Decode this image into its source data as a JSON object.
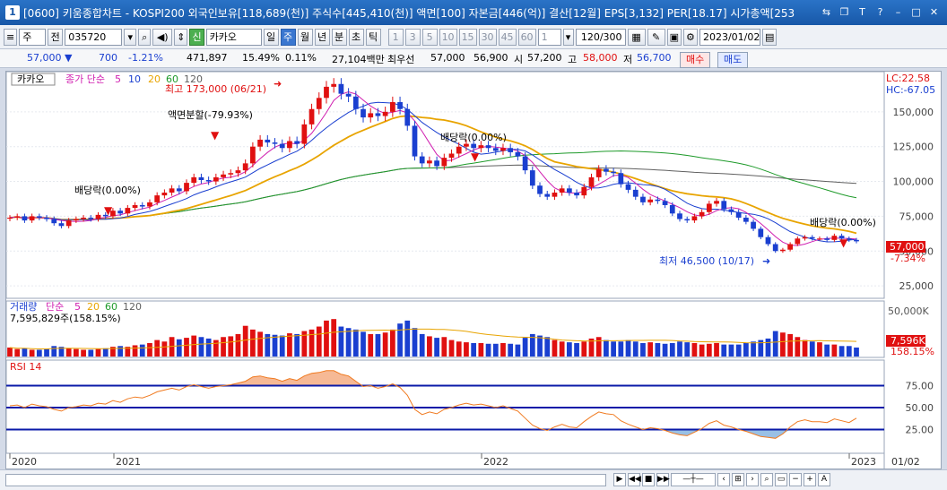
{
  "window": {
    "title": "[0600] 키움종합차트 - KOSPI200 외국인보유[118,689(천)] 주식수[445,410(천)] 액면[100] 자본금[446(억)] 결산[12월] EPS[3,132] PER[18.17] 시가총액[253",
    "app_number": "1"
  },
  "toolbar": {
    "period_select": "주",
    "all_label": "전",
    "code": "035720",
    "stock_name": "카카오",
    "periods": [
      "일",
      "주",
      "월",
      "년",
      "분",
      "초",
      "틱"
    ],
    "active_period": "주",
    "numbers": [
      "1",
      "3",
      "5",
      "10",
      "15",
      "30",
      "45",
      "60"
    ],
    "count_value": "1",
    "range": "120/300",
    "date": "2023/01/02"
  },
  "quote": {
    "price": "57,000",
    "change": "700",
    "change_pct": "-1.21%",
    "volume": "471,897",
    "vol_ratio": "15.49%",
    "turnover": "0.11%",
    "amount": "27,104백만",
    "best_label": "최우선",
    "ask": "57,000",
    "bid": "56,900",
    "open_label": "시",
    "open": "57,200",
    "high_label": "고",
    "high": "58,000",
    "low_label": "저",
    "low": "56,700",
    "buy_label": "매수",
    "sell_label": "매도"
  },
  "price_panel": {
    "stock_tag": "카카오",
    "legend_prefix": "종가 단순",
    "ma_labels": [
      "5",
      "10",
      "20",
      "60",
      "120"
    ],
    "lc_label": "LC:22.58",
    "hc_label": "HC:-67.05",
    "last_price_label": "57,000",
    "last_pct_label": "-7.34%",
    "annotations": {
      "high": "최고 173,000 (06/21)",
      "split": "액면분할(-79.93%)",
      "div1": "배당락(0.00%)",
      "div2": "배당락(0.00%)",
      "div3": "배당락(0.00%)",
      "low": "최저 46,500 (10/17)"
    }
  },
  "volume_panel": {
    "title": "거래량",
    "legend_prefix": "단순",
    "ma_labels": [
      "5",
      "20",
      "60",
      "120"
    ],
    "value_text": "7,595,829주(158.15%)",
    "max_label": "50,000K",
    "last_label": "7,596K",
    "last_pct": "158.15%"
  },
  "rsi_panel": {
    "title": "RSI 14",
    "levels": [
      "75.00",
      "50.00",
      "25.00"
    ]
  },
  "xaxis": {
    "labels": [
      "2020",
      "2021",
      "2022",
      "2023"
    ],
    "right_date": "01/02"
  },
  "colors": {
    "up": "#e01010",
    "down": "#1a3fd0",
    "ma5": "#d01fb0",
    "ma10": "#1a3fd0",
    "ma20": "#e8a400",
    "ma60": "#1e9a2a",
    "ma120": "#606060",
    "rsi_line": "#f07a20",
    "rsi_band": "#0a1aa8"
  },
  "chart_data": {
    "type": "candlestick",
    "x_start": "2020-01",
    "x_end": "2023-01-02",
    "y_ticks": [
      25000,
      50000,
      75000,
      100000,
      125000,
      150000
    ],
    "ylim": [
      18000,
      175000
    ],
    "closes": [
      74000,
      75000,
      72000,
      75000,
      74000,
      73000,
      70000,
      68000,
      72000,
      73000,
      74000,
      73000,
      76000,
      75000,
      79000,
      77000,
      81000,
      83000,
      82000,
      85000,
      90000,
      92000,
      95000,
      93000,
      99000,
      103000,
      101000,
      100000,
      103000,
      105000,
      106000,
      108000,
      113000,
      125000,
      130000,
      128000,
      127000,
      124000,
      129000,
      127000,
      141000,
      152000,
      160000,
      168000,
      170000,
      163000,
      161000,
      152000,
      146000,
      149000,
      147000,
      150000,
      157000,
      152000,
      140000,
      118000,
      113000,
      115000,
      111000,
      117000,
      120000,
      125000,
      127000,
      124000,
      126000,
      124000,
      122000,
      124000,
      121000,
      118000,
      108000,
      97000,
      91000,
      89000,
      92000,
      95000,
      92000,
      90000,
      96000,
      103000,
      109000,
      107000,
      106000,
      98000,
      94000,
      89000,
      85000,
      87000,
      86000,
      83000,
      77000,
      73000,
      72000,
      75000,
      78000,
      84000,
      86000,
      80000,
      78000,
      74000,
      71000,
      66000,
      60000,
      55000,
      50000,
      51000,
      55000,
      59000,
      60000,
      59000,
      59000,
      58000,
      61000,
      59000,
      58000,
      57000
    ],
    "rsi": [
      52,
      53,
      50,
      54,
      52,
      51,
      48,
      46,
      50,
      51,
      53,
      52,
      55,
      54,
      58,
      56,
      60,
      62,
      61,
      64,
      68,
      70,
      72,
      70,
      74,
      76,
      74,
      72,
      74,
      75,
      76,
      78,
      80,
      85,
      86,
      84,
      83,
      80,
      83,
      81,
      86,
      89,
      90,
      92,
      92,
      88,
      86,
      80,
      74,
      75,
      72,
      74,
      77,
      73,
      64,
      48,
      42,
      45,
      43,
      48,
      50,
      53,
      55,
      53,
      54,
      52,
      50,
      52,
      49,
      46,
      38,
      30,
      26,
      24,
      28,
      31,
      28,
      27,
      34,
      40,
      45,
      43,
      42,
      35,
      31,
      28,
      25,
      27,
      26,
      24,
      21,
      19,
      18,
      22,
      26,
      32,
      35,
      30,
      28,
      25,
      23,
      20,
      17,
      16,
      15,
      20,
      28,
      34,
      36,
      34,
      34,
      33,
      37,
      35,
      33,
      38
    ],
    "volume": [
      12,
      10,
      11,
      9,
      9,
      10,
      14,
      13,
      11,
      10,
      9,
      9,
      10,
      11,
      13,
      14,
      13,
      15,
      16,
      18,
      22,
      20,
      26,
      23,
      25,
      28,
      26,
      24,
      22,
      26,
      27,
      30,
      41,
      36,
      33,
      30,
      29,
      28,
      31,
      30,
      34,
      36,
      40,
      48,
      50,
      40,
      38,
      36,
      33,
      30,
      30,
      32,
      36,
      44,
      48,
      38,
      30,
      27,
      25,
      26,
      22,
      20,
      19,
      18,
      18,
      17,
      17,
      18,
      17,
      16,
      25,
      30,
      28,
      26,
      22,
      20,
      19,
      18,
      20,
      24,
      26,
      22,
      20,
      20,
      22,
      20,
      18,
      19,
      18,
      17,
      18,
      20,
      19,
      18,
      16,
      17,
      18,
      16,
      16,
      16,
      18,
      20,
      22,
      24,
      34,
      32,
      30,
      26,
      22,
      20,
      19,
      16,
      16,
      14,
      14,
      12
    ]
  }
}
